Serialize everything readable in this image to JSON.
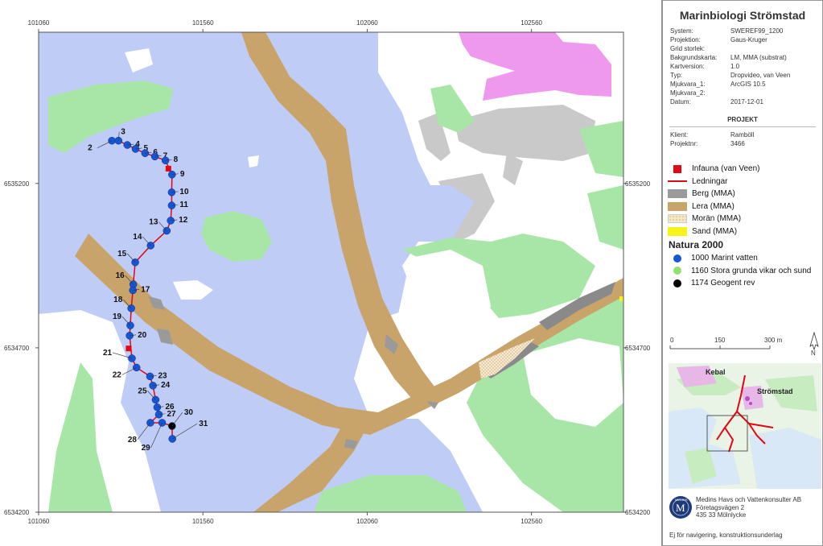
{
  "map": {
    "x_ticks": [
      "101060",
      "101560",
      "102060",
      "102560"
    ],
    "y_ticks": [
      "6535200",
      "6534700",
      "6534200"
    ],
    "points": [
      {
        "id": "2",
        "x": 101283,
        "y": 6535330
      },
      {
        "id": "3",
        "x": 101303,
        "y": 6535330
      },
      {
        "id": "4",
        "x": 101330,
        "y": 6535317
      },
      {
        "id": "5",
        "x": 101355,
        "y": 6535305
      },
      {
        "id": "6",
        "x": 101384,
        "y": 6535292
      },
      {
        "id": "7",
        "x": 101414,
        "y": 6535282
      },
      {
        "id": "8",
        "x": 101446,
        "y": 6535270
      },
      {
        "id": "9",
        "x": 101466,
        "y": 6535227
      },
      {
        "id": "10",
        "x": 101465,
        "y": 6535173
      },
      {
        "id": "11",
        "x": 101465,
        "y": 6535133
      },
      {
        "id": "12",
        "x": 101462,
        "y": 6535087
      },
      {
        "id": "13",
        "x": 101450,
        "y": 6535056
      },
      {
        "id": "14",
        "x": 101401,
        "y": 6535011
      },
      {
        "id": "15",
        "x": 101354,
        "y": 6534960
      },
      {
        "id": "16",
        "x": 101348,
        "y": 6534893
      },
      {
        "id": "17",
        "x": 101347,
        "y": 6534875
      },
      {
        "id": "18",
        "x": 101342,
        "y": 6534820
      },
      {
        "id": "19",
        "x": 101339,
        "y": 6534768
      },
      {
        "id": "20",
        "x": 101337,
        "y": 6534737
      },
      {
        "id": "21",
        "x": 101344,
        "y": 6534668
      },
      {
        "id": "22",
        "x": 101358,
        "y": 6534640
      },
      {
        "id": "23",
        "x": 101399,
        "y": 6534613
      },
      {
        "id": "24",
        "x": 101408,
        "y": 6534585
      },
      {
        "id": "25",
        "x": 101416,
        "y": 6534542
      },
      {
        "id": "26",
        "x": 101421,
        "y": 6534519
      },
      {
        "id": "27",
        "x": 101426,
        "y": 6534497
      },
      {
        "id": "28",
        "x": 101400,
        "y": 6534472
      },
      {
        "id": "29",
        "x": 101436,
        "y": 6534472
      },
      {
        "id": "30",
        "x": 101466,
        "y": 6534462,
        "type": "1174"
      },
      {
        "id": "31",
        "x": 101467,
        "y": 6534423
      }
    ],
    "infauna": [
      {
        "x": 101455,
        "y": 6535245
      },
      {
        "x": 101334,
        "y": 6534698
      }
    ]
  },
  "panel": {
    "title": "Marinbiologi Strömstad",
    "meta": [
      {
        "k": "System:",
        "v": "SWEREF99_1200"
      },
      {
        "k": "Projektion:",
        "v": "Gaus-Kruger"
      },
      {
        "k": "Grid storlek:",
        "v": ""
      },
      {
        "k": "Bakgrundskarta:",
        "v": "LM, MMA (substrat)"
      },
      {
        "k": "Kartversion:",
        "v": "1.0"
      },
      {
        "k": "Typ:",
        "v": "Dropvideo, van Veen"
      },
      {
        "k": "Mjukvara_1:",
        "v": "ArcGIS 10.5"
      },
      {
        "k": "Mjukvara_2:",
        "v": ""
      },
      {
        "k": "Datum:",
        "v": "2017-12-01"
      }
    ],
    "project_heading": "PROJEKT",
    "project": [
      {
        "k": "Klient:",
        "v": "Ramböll"
      },
      {
        "k": "Projektnr:",
        "v": "3466"
      }
    ],
    "legend": [
      {
        "label": "Infauna (van Veen)",
        "kind": "square",
        "color": "#e30613"
      },
      {
        "label": "Ledningar",
        "kind": "line",
        "color": "#e30613"
      },
      {
        "label": "Berg (MMA)",
        "kind": "fill",
        "color": "#9a9a9a"
      },
      {
        "label": "Lera (MMA)",
        "kind": "fill",
        "color": "#c8a46a"
      },
      {
        "label": "Morän (MMA)",
        "kind": "dots",
        "color": "#f3e7c4"
      },
      {
        "label": "Sand (MMA)",
        "kind": "fill",
        "color": "#f7f21a"
      }
    ],
    "natura_heading": "Natura 2000",
    "natura": [
      {
        "label": "1000 Marint vatten",
        "color": "#1655d6"
      },
      {
        "label": "1160 Stora grunda vikar och sund",
        "color": "#8be36b"
      },
      {
        "label": "1174 Geogent rev",
        "color": "#000000"
      }
    ],
    "scale": {
      "l0": "0",
      "l1": "150",
      "l2": "300 m"
    },
    "north": "N",
    "inset": {
      "label1": "Kebal",
      "label2": "Strömstad"
    },
    "company": {
      "logo_text": "M",
      "logo_ring": "MEDINS",
      "name": "Medins Havs och Vattenkonsulter AB",
      "addr1": "Företagsvägen 2",
      "addr2": "435 33 Mölnlycke"
    },
    "disclaimer": "Ej för navigering, konstruktionsunderlag"
  },
  "colors": {
    "water": "#bfcdf6",
    "land": "#ffffff",
    "grass": "#a8e6a8",
    "clay": "#c8a46a",
    "rock": "#9a9a9a",
    "urban": "#ee99ee",
    "route": "#e30613",
    "point": "#1655d6"
  }
}
